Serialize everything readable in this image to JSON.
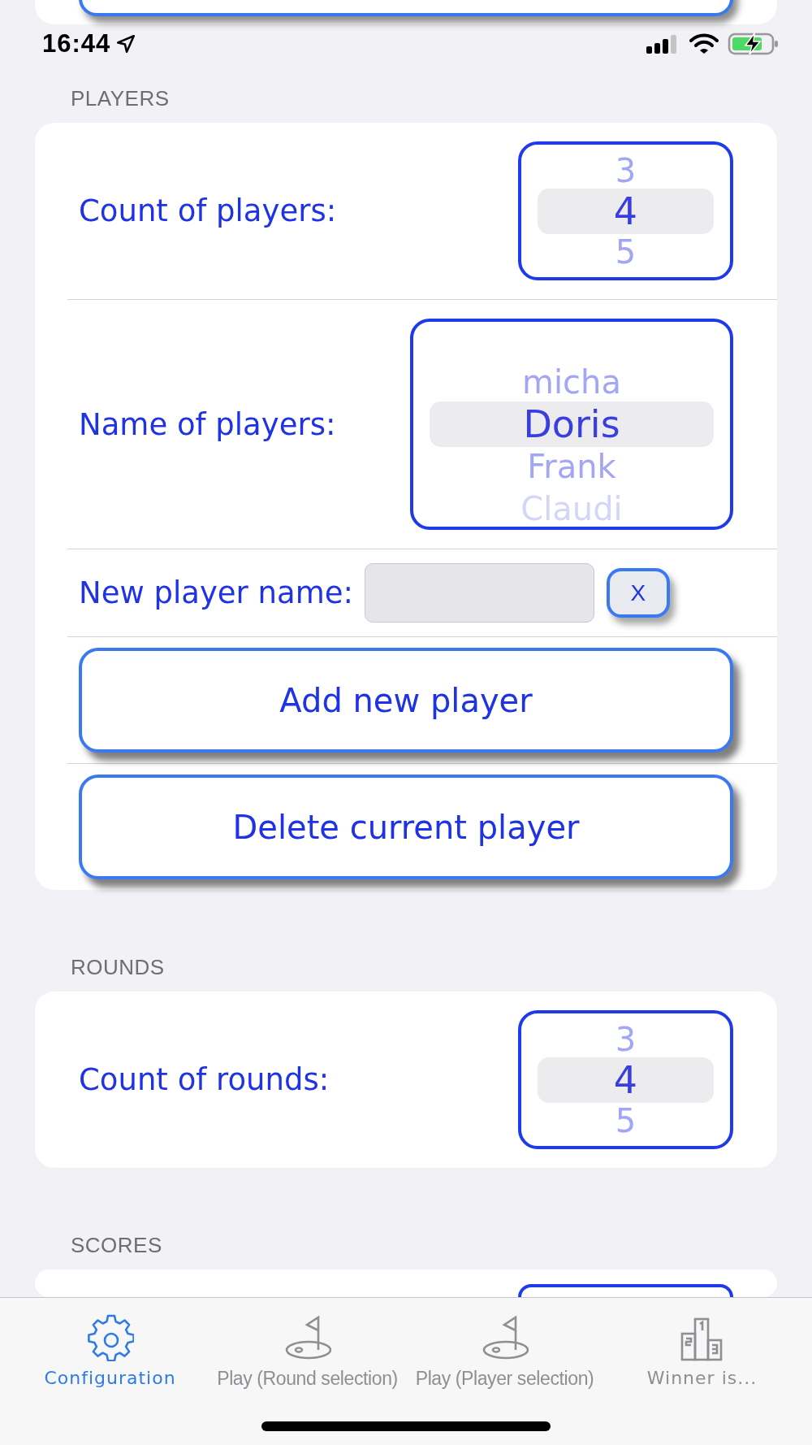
{
  "status_bar": {
    "time": "16:44"
  },
  "sections": [
    {
      "header": "PLAYERS",
      "rows": [
        {
          "kind": "picker",
          "label": "Count of players:",
          "options": [
            {
              "text": "3",
              "selected": false
            },
            {
              "text": "4",
              "selected": true
            },
            {
              "text": "5",
              "selected": false
            }
          ]
        },
        {
          "kind": "tall_picker",
          "label": "Name of players:",
          "options": [
            {
              "text": "micha",
              "selected": false
            },
            {
              "text": "Doris",
              "selected": true
            },
            {
              "text": "Frank",
              "selected": false
            },
            {
              "text": "Claudi",
              "selected": false
            }
          ]
        },
        {
          "kind": "text_input",
          "label": "New player name:",
          "clear_button": "X"
        },
        {
          "kind": "button",
          "label": "Add new player"
        },
        {
          "kind": "button",
          "label": "Delete current player"
        }
      ]
    },
    {
      "header": "ROUNDS",
      "rows": [
        {
          "kind": "picker",
          "label": "Count of rounds:",
          "options": [
            {
              "text": "3",
              "selected": false
            },
            {
              "text": "4",
              "selected": true
            },
            {
              "text": "5",
              "selected": false
            }
          ]
        }
      ]
    },
    {
      "header": "SCORES",
      "rows": [
        {
          "kind": "clipped_picker"
        }
      ]
    }
  ],
  "tab_bar": [
    {
      "label": "Configuration",
      "kind": "settings",
      "selected": true
    },
    {
      "label": "Play (Round selection)",
      "kind": "play",
      "selected": false
    },
    {
      "label": "Play (Player selection)",
      "kind": "play",
      "selected": false
    },
    {
      "label": "Winner is...",
      "kind": "results",
      "selected": false
    }
  ]
}
